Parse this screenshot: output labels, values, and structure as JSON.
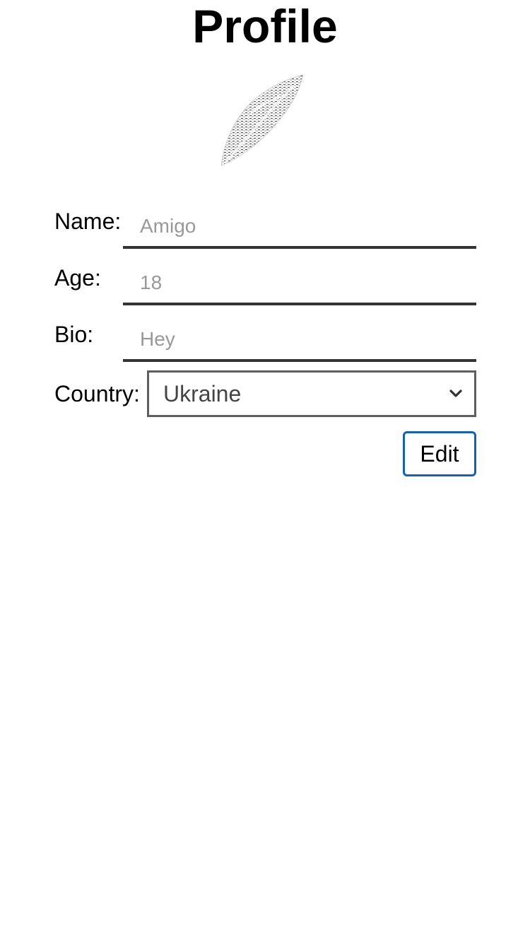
{
  "page": {
    "title": "Profile"
  },
  "avatar": {
    "icon": "feather-icon"
  },
  "form": {
    "name": {
      "label": "Name:",
      "value": "",
      "placeholder": "Amigo"
    },
    "age": {
      "label": "Age:",
      "value": "",
      "placeholder": "18"
    },
    "bio": {
      "label": "Bio:",
      "value": "",
      "placeholder": "Hey"
    },
    "country": {
      "label": "Country:",
      "selected": "Ukraine"
    }
  },
  "actions": {
    "edit_label": "Edit"
  },
  "colors": {
    "accent": "#1561b3",
    "field_underline": "#333333",
    "placeholder": "#999999",
    "select_border": "#5f5f5f"
  }
}
